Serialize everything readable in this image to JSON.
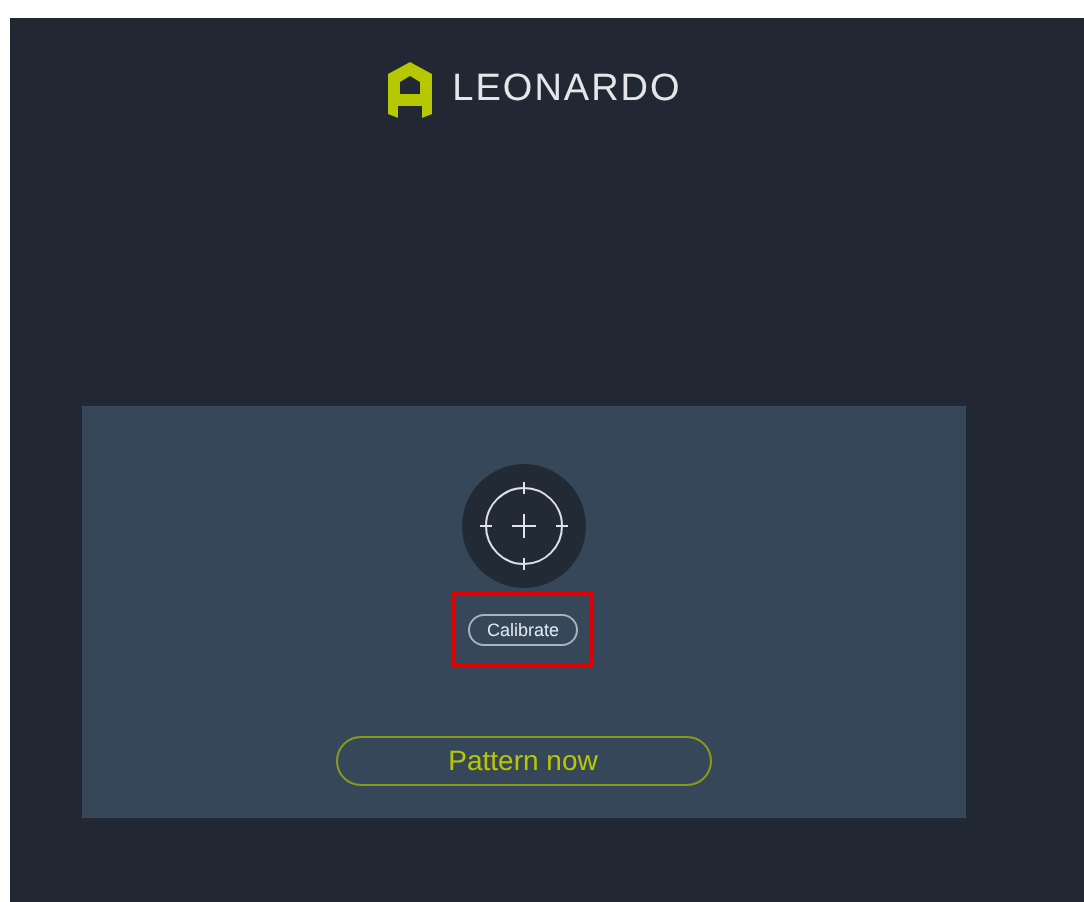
{
  "brand": {
    "name": "LEONARDO"
  },
  "calibrate_button": {
    "label": "Calibrate",
    "highlighted": true
  },
  "pattern_button": {
    "label": "Pattern now"
  }
}
